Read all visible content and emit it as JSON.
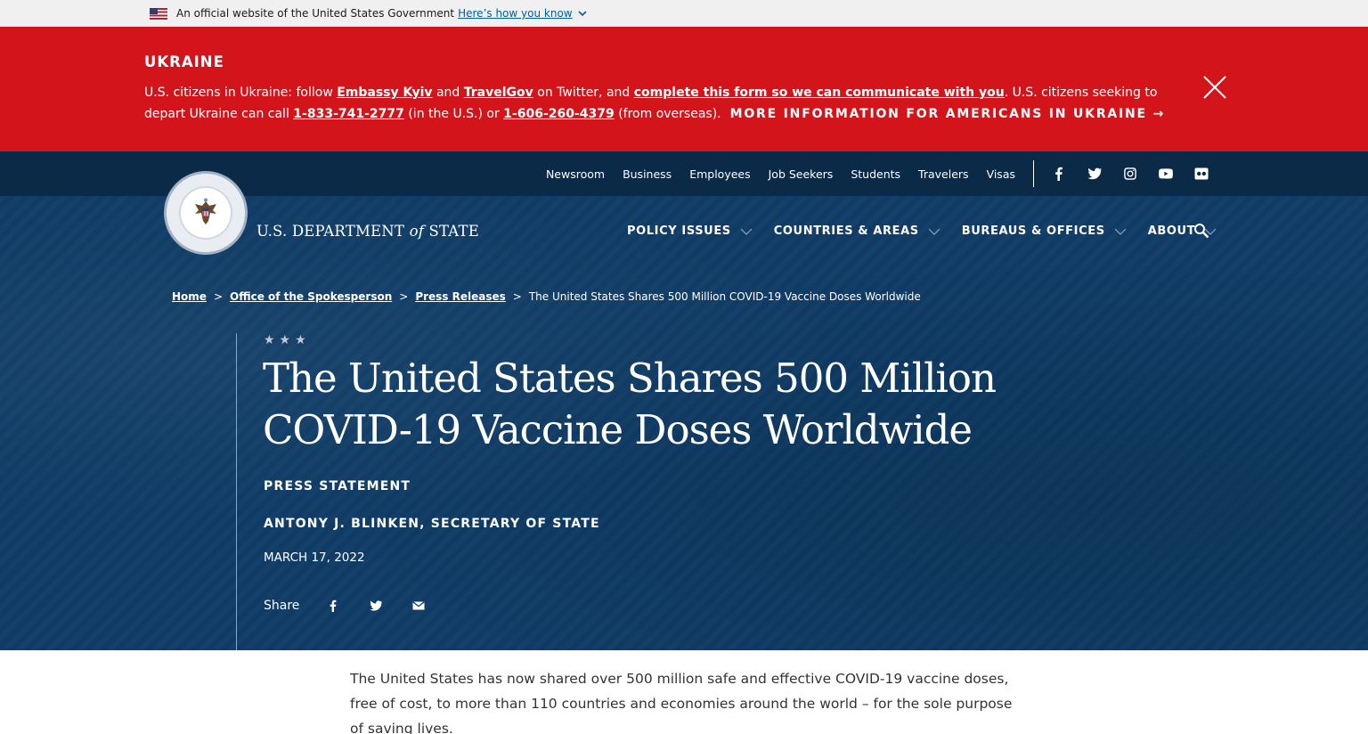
{
  "gov_banner": {
    "text": "An official website of the United States Government",
    "link": "Here’s how you know"
  },
  "alert": {
    "heading": "UKRAINE",
    "p1": "U.S. citizens in Ukraine: follow ",
    "link_embassy": "Embassy Kyiv",
    "and": " and ",
    "link_travelgov": "TravelGov",
    "p2": " on Twitter, and ",
    "link_form": "complete this form so we can communicate with you",
    "p3": ". U.S. citizens seeking to depart Ukraine can call ",
    "phone_us": "1-833-741-2777",
    "p4": " (in the U.S.) or ",
    "phone_overseas": "1-606-260-4379",
    "p5": " (from overseas).",
    "more": "MORE INFORMATION FOR AMERICANS IN UKRAINE →"
  },
  "utility_nav": [
    "Newsroom",
    "Business",
    "Employees",
    "Job Seekers",
    "Students",
    "Travelers",
    "Visas"
  ],
  "social_icons": [
    "facebook-icon",
    "twitter-icon",
    "instagram-icon",
    "youtube-icon",
    "flickr-icon"
  ],
  "logo": {
    "pre": "U.S. DEPARTMENT ",
    "of": "of",
    "post": " STATE"
  },
  "main_nav": [
    "POLICY ISSUES",
    "COUNTRIES & AREAS",
    "BUREAUS & OFFICES",
    "ABOUT"
  ],
  "breadcrumb": {
    "home": "Home",
    "spokesperson": "Office of the Spokesperson",
    "press": "Press Releases",
    "current": "The United States Shares 500 Million COVID-19 Vaccine Doses Worldwide",
    "sep": ">"
  },
  "article": {
    "stars": "★★★",
    "title": "The United States Shares 500 Million COVID-19 Vaccine Doses Worldwide",
    "kind": "PRESS STATEMENT",
    "author": "ANTONY J. BLINKEN, SECRETARY OF STATE",
    "date": "MARCH 17, 2022",
    "share_label": "Share",
    "body": "The United States has now shared over 500 million safe and effective COVID-19 vaccine doses, free of cost, to more than 110 countries and economies around the world – for the sole purpose of saving lives."
  },
  "colors": {
    "alert_red": "#d3151b",
    "hero_navy": "#0f3c66",
    "utility_navy": "#0a2a47",
    "accent_gold": "#c59c67"
  }
}
